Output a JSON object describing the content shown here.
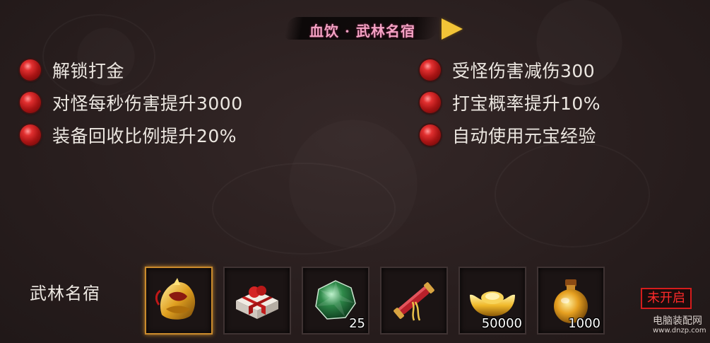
{
  "title": "血饮 · 武林名宿",
  "perks_left": [
    {
      "text": "解锁打金"
    },
    {
      "text": "对怪每秒伤害提升3000"
    },
    {
      "text": "装备回收比例提升20%"
    }
  ],
  "perks_right": [
    {
      "text": "受怪伤害减伤300"
    },
    {
      "text": "打宝概率提升10%"
    },
    {
      "text": "自动使用元宝经验"
    }
  ],
  "reward_row": {
    "label": "武林名宿",
    "items": [
      {
        "icon": "golden-armor-icon",
        "qty": "",
        "selected": true
      },
      {
        "icon": "gift-box-icon",
        "qty": ""
      },
      {
        "icon": "green-gem-icon",
        "qty": "25"
      },
      {
        "icon": "red-scroll-icon",
        "qty": ""
      },
      {
        "icon": "gold-ingot-icon",
        "qty": "50000"
      },
      {
        "icon": "gold-potion-icon",
        "qty": "1000"
      }
    ],
    "status": "未开启"
  },
  "watermark": {
    "name": "电脑装配网",
    "url": "www.dnzp.com"
  },
  "colors": {
    "title": "#f4a2c4",
    "arrow": "#f2c437",
    "bullet": "#c21f1f",
    "selected_border": "#c98a2c",
    "status": "#ff2a2a"
  }
}
